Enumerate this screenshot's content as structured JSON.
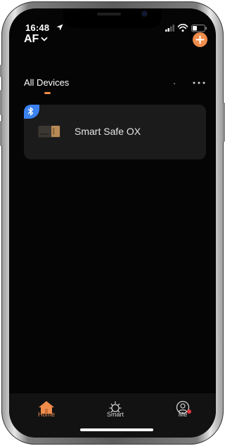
{
  "status_bar": {
    "time": "16:48",
    "location_icon": "location-arrow-icon",
    "signal_icon": "cellular-signal-icon",
    "wifi_icon": "wifi-icon",
    "battery_icon": "battery-icon"
  },
  "header": {
    "home_name": "AF",
    "dropdown_icon": "chevron-down-icon",
    "add_icon": "plus-icon"
  },
  "tabs": {
    "all_devices": "All Devices",
    "more_icon": "more-horizontal-icon"
  },
  "devices": [
    {
      "name": "Smart Safe OX",
      "icon": "smart-safe-icon",
      "badge_icon": "bluetooth-icon"
    }
  ],
  "tabbar": {
    "home_label": "Home",
    "smart_label": "Smart",
    "me_label": "Me",
    "home_icon": "home-icon",
    "smart_icon": "sun-icon",
    "me_icon": "profile-icon"
  },
  "colors": {
    "accent": "#ef8c4c",
    "screen_bg": "#050505",
    "card_bg": "#1b1b1b",
    "bluetooth_badge": "#3b82f0",
    "notification_dot": "#e5363d"
  }
}
